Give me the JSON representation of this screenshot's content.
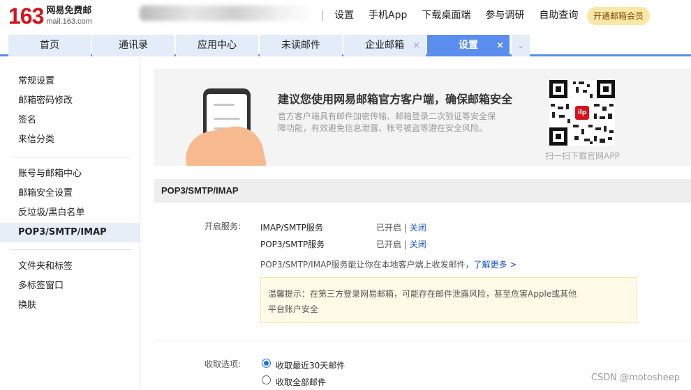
{
  "header": {
    "logo_num": "163",
    "logo_cn": "网易免费邮",
    "logo_url": "mail.163.com",
    "links": [
      "设置",
      "手机App",
      "下载桌面端",
      "参与调研",
      "自助查询"
    ],
    "vip_button": "开通邮箱会员"
  },
  "tabs": [
    {
      "label": "首页"
    },
    {
      "label": "通讯录"
    },
    {
      "label": "应用中心"
    },
    {
      "label": "未读邮件"
    },
    {
      "label": "企业邮箱",
      "close": "×"
    },
    {
      "label": "设置",
      "close": "×",
      "active": true
    }
  ],
  "tab_more_icon": "chevron-down-icon",
  "sidebar": {
    "groups": [
      [
        "常规设置",
        "邮箱密码修改",
        "签名",
        "来信分类"
      ],
      [
        "账号与邮箱中心",
        "邮箱安全设置",
        "反垃圾/黑白名单",
        "POP3/SMTP/IMAP"
      ],
      [
        "文件夹和标签",
        "多标签窗口",
        "换肤"
      ]
    ],
    "active": "POP3/SMTP/IMAP"
  },
  "banner": {
    "title": "建议您使用网易邮箱官方客户端，确保邮箱安全",
    "desc": "官方客户端具有邮件加密传输、邮箱登录二次验证等安全保障功能，有效避免信息泄露、帐号被盗等潜在安全风险。",
    "qr_caption": "扫一扫下载官网APP",
    "qr_logo": "ilp"
  },
  "section": {
    "title": "POP3/SMTP/IMAP",
    "service_label": "开启服务:",
    "services": [
      {
        "name": "IMAP/SMTP服务",
        "status": "已开启",
        "sep": "|",
        "action": "关闭"
      },
      {
        "name": "POP3/SMTP服务",
        "status": "已开启",
        "sep": "|",
        "action": "关闭"
      }
    ],
    "desc": "POP3/SMTP/IMAP服务能让你在本地客户端上收发邮件，",
    "learn_more": "了解更多 >",
    "tip_line1": "温馨提示：在第三方登录网易邮箱，可能存在邮件泄露风险，甚至危害Apple或其他",
    "tip_line2": "平台账户安全",
    "receive_label": "收取选项:",
    "receive_options": [
      {
        "label": "收取最近30天邮件",
        "checked": true
      },
      {
        "label": "收取全部邮件",
        "checked": false
      }
    ]
  },
  "watermark": "CSDN @motosheep",
  "colors": {
    "brand_red": "#d6121b",
    "tab_active": "#5b8def",
    "link": "#1a55c9"
  }
}
